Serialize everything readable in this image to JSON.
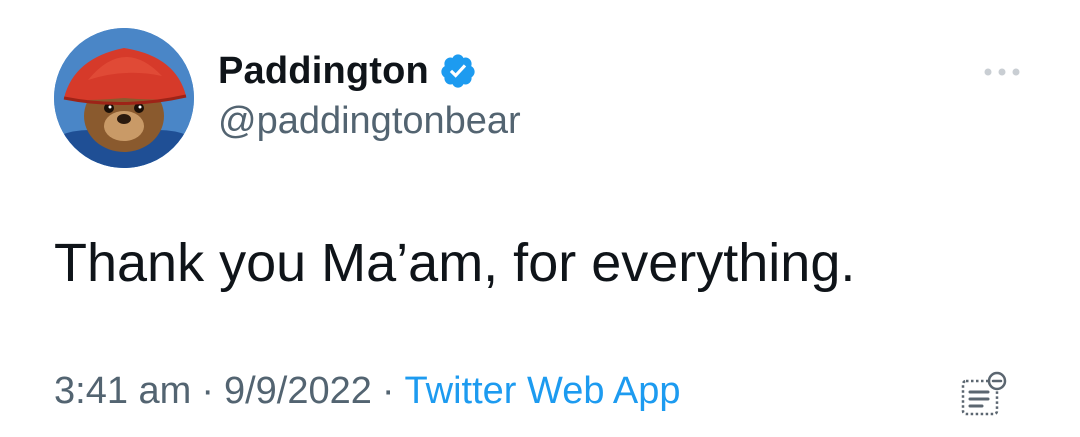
{
  "tweet": {
    "author": {
      "name": "Paddington",
      "handle": "@paddingtonbear",
      "verified": true,
      "verified_color": "#1d9bf0",
      "avatar_icon": "paddington-bear-avatar"
    },
    "text": "Thank you Ma’am, for everything.",
    "meta": {
      "time": "3:41 am",
      "separator": "·",
      "date": "9/9/2022",
      "source": "Twitter Web App",
      "source_color": "#1d9bf0"
    },
    "more_icon": "more-options-icon",
    "notes_icon": "tweet-notes-icon"
  }
}
